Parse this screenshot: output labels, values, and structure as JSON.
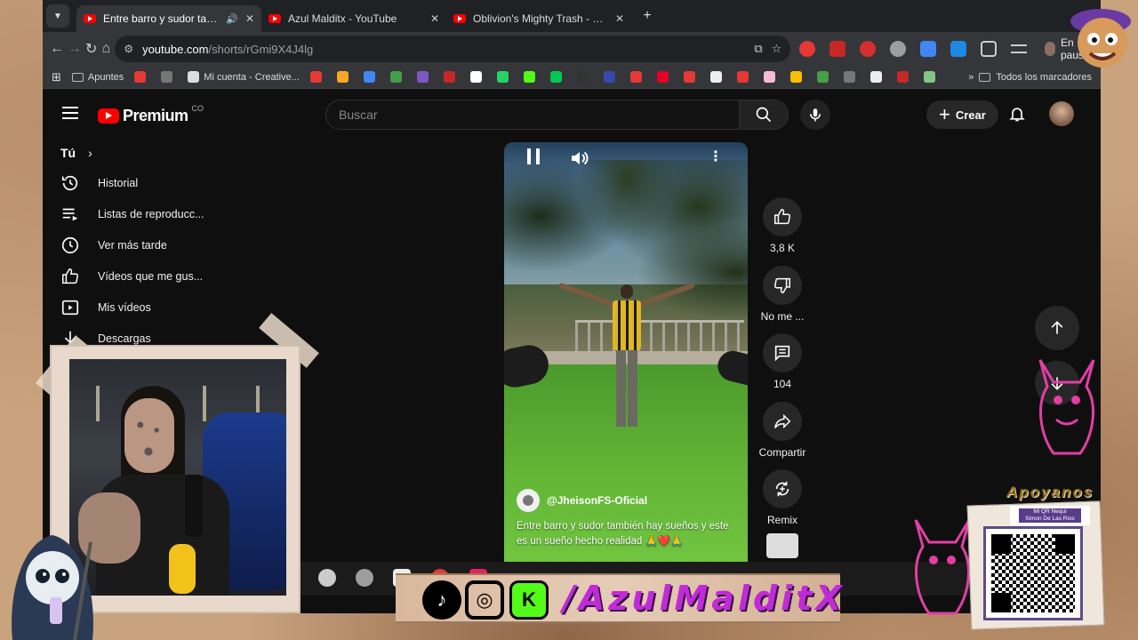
{
  "browser": {
    "tabs": [
      {
        "title": "Entre barro y sudor también",
        "active": true,
        "audio": true
      },
      {
        "title": "Azul Malditx - YouTube",
        "active": false,
        "audio": false
      },
      {
        "title": "Oblivion's Mighty Trash - No M",
        "active": false,
        "audio": false
      }
    ],
    "url_host": "youtube.com",
    "url_path": "/shorts/rGmi9X4J4lg",
    "profile_label": "En pausa",
    "bookmarks": [
      {
        "label": "Apuntes",
        "color": "#9aa0a6",
        "folder": true
      },
      {
        "label": "",
        "color": "#e53935"
      },
      {
        "label": "",
        "color": "#777777"
      },
      {
        "label": "Mi cuenta - Creative...",
        "color": "#dddddd"
      },
      {
        "label": "",
        "color": "#e53935"
      },
      {
        "label": "",
        "color": "#f9a825"
      },
      {
        "label": "",
        "color": "#4285f4"
      },
      {
        "label": "",
        "color": "#43a047"
      },
      {
        "label": "",
        "color": "#7e57c2"
      },
      {
        "label": "",
        "color": "#c62828"
      },
      {
        "label": "",
        "color": "#ffffff"
      },
      {
        "label": "",
        "color": "#25d366"
      },
      {
        "label": "",
        "color": "#53fc18"
      },
      {
        "label": "",
        "color": "#00c853"
      },
      {
        "label": "",
        "color": "#333333"
      },
      {
        "label": "",
        "color": "#3949ab"
      },
      {
        "label": "",
        "color": "#e53935"
      },
      {
        "label": "",
        "color": "#e60023"
      },
      {
        "label": "",
        "color": "#e53935"
      },
      {
        "label": "",
        "color": "#eeeeee"
      },
      {
        "label": "",
        "color": "#e53935"
      },
      {
        "label": "",
        "color": "#f8bbd0"
      },
      {
        "label": "",
        "color": "#fbbc04"
      },
      {
        "label": "",
        "color": "#43a047"
      },
      {
        "label": "",
        "color": "#777777"
      },
      {
        "label": "",
        "color": "#eeeeee"
      },
      {
        "label": "",
        "color": "#c62828"
      },
      {
        "label": "",
        "color": "#81c784"
      }
    ],
    "all_bookmarks_label": "Todos los marcadores"
  },
  "youtube": {
    "logo_text": "Premium",
    "country_code": "CO",
    "search_placeholder": "Buscar",
    "create_label": "Crear",
    "sidebar": {
      "section": "Tú",
      "items": [
        {
          "label": "Historial",
          "icon": "history-icon"
        },
        {
          "label": "Listas de reproducc...",
          "icon": "playlists-icon"
        },
        {
          "label": "Ver más tarde",
          "icon": "watch-later-icon"
        },
        {
          "label": "Vídeos que me gus...",
          "icon": "liked-videos-icon"
        },
        {
          "label": "Mis vídeos",
          "icon": "my-videos-icon"
        },
        {
          "label": "Descargas",
          "icon": "downloads-icon"
        }
      ]
    },
    "short": {
      "channel": "@JheisonFS-Oficial",
      "description": "Entre barro y sudor también hay sueños y este es un sueño hecho realidad 🙏❤️🙏"
    },
    "actions": {
      "like_count": "3,8 K",
      "dislike_label": "No me ...",
      "comments_count": "104",
      "share_label": "Compartir",
      "remix_label": "Remix"
    }
  },
  "overlay": {
    "social_handle": "/AzulMalditX",
    "support_label": "Apoyanos",
    "qr_caption_1": "Mi QR Nequi",
    "qr_caption_2": "Simon De Las Rios",
    "accent_color": "#c02bd8"
  }
}
